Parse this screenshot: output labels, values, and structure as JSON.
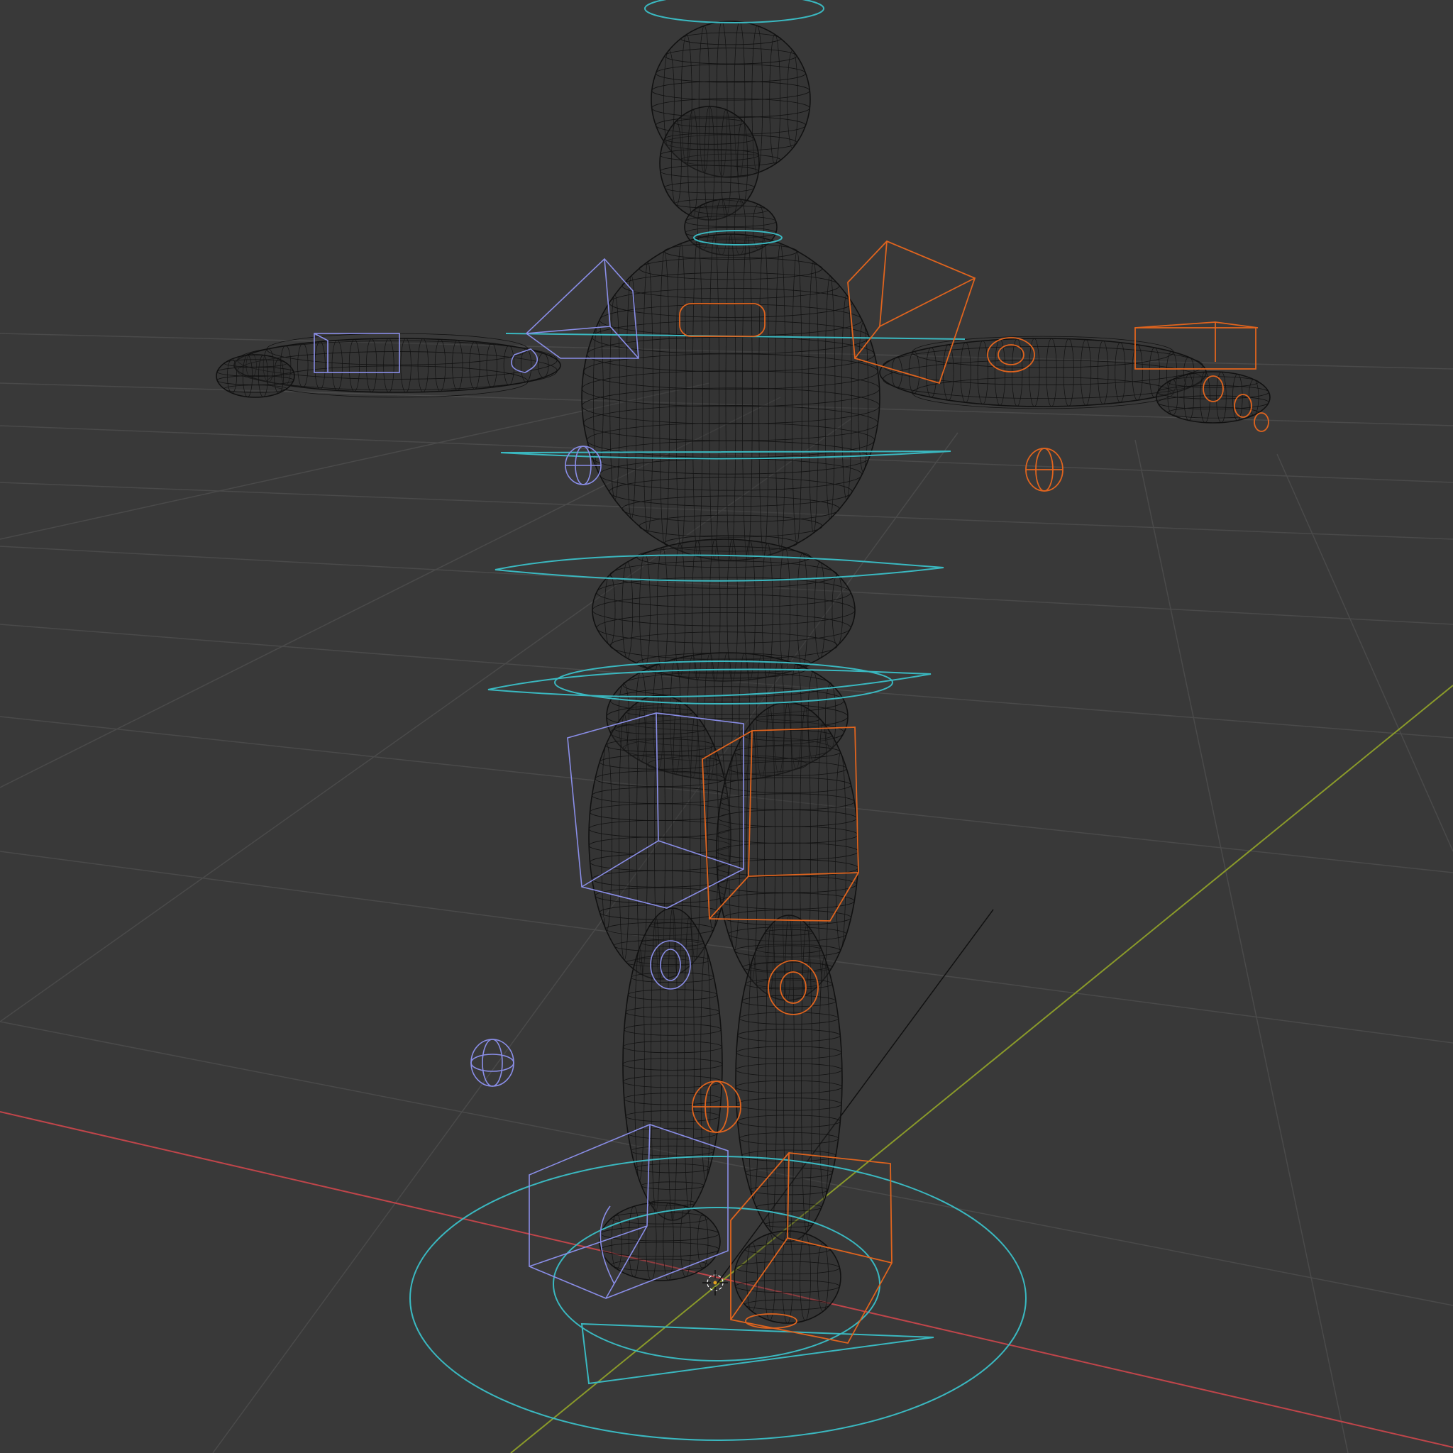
{
  "viewport": {
    "editor": "3D Viewport",
    "shading": "wireframe",
    "background_color": "#393939",
    "grid_color": "#4a4a4a",
    "x_axis_color": "#c0454a",
    "y_axis_color": "#8a9a2a",
    "mesh_wire_color": "#111111"
  },
  "rig": {
    "root_control_color": "#3ab8c0",
    "left_side_controls_color": "#8a8ee8",
    "right_side_controls_color": "#e0641e",
    "control_shapes": [
      "circle",
      "cube",
      "sphere",
      "ring"
    ]
  },
  "scene_objects": [
    "character-mesh",
    "armature",
    "3d-cursor",
    "camera-sight-line"
  ]
}
